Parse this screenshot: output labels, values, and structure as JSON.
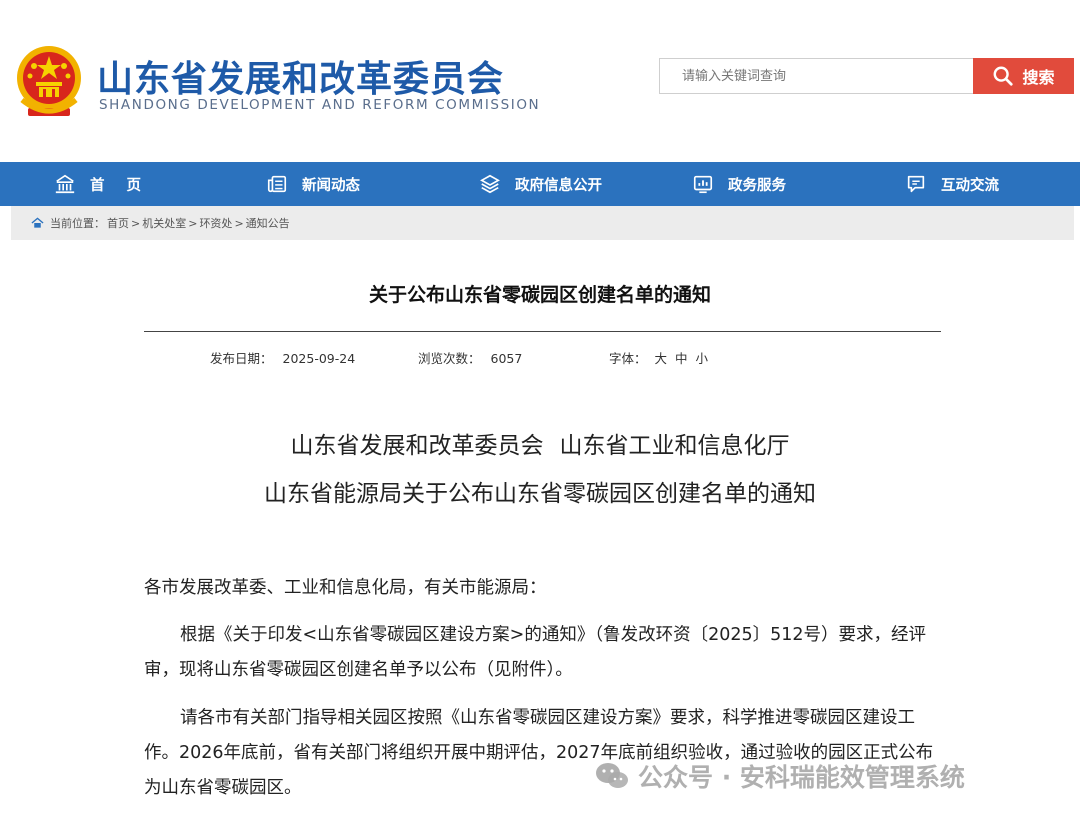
{
  "header": {
    "site_title": "山东省发展和改革委员会",
    "site_subtitle": "SHANDONG DEVELOPMENT AND REFORM COMMISSION",
    "emblem_icon": "national-emblem-icon",
    "search": {
      "placeholder": "请输入关键词查询",
      "button_label": "搜索"
    }
  },
  "nav": {
    "items": [
      {
        "label": "首页",
        "icon": "home-icon"
      },
      {
        "label": "新闻动态",
        "icon": "news-icon"
      },
      {
        "label": "政府信息公开",
        "icon": "layers-icon"
      },
      {
        "label": "政务服务",
        "icon": "chart-icon"
      },
      {
        "label": "互动交流",
        "icon": "chat-icon"
      }
    ]
  },
  "breadcrumb": {
    "prefix": "当前位置：",
    "items": [
      "首页",
      "机关处室",
      "环资处",
      "通知公告"
    ],
    "separator": ">"
  },
  "article": {
    "title": "关于公布山东省零碳园区创建名单的通知",
    "meta": {
      "date_label": "发布日期：",
      "date": "2025-09-24",
      "views_label": "浏览次数：",
      "views": "6057",
      "font_label": "字体：",
      "font_options": [
        "大",
        "中",
        "小"
      ]
    },
    "heading_line1_a": "山东省发展和改革委员会",
    "heading_line1_b": "山东省工业和信息化厅",
    "heading_line2": "山东省能源局关于公布山东省零碳园区创建名单的通知",
    "salutation": "各市发展改革委、工业和信息化局，有关市能源局：",
    "para1": "根据《关于印发<山东省零碳园区建设方案>的通知》（鲁发改环资〔2025〕512号）要求，经评审，现将山东省零碳园区创建名单予以公布（见附件）。",
    "para2": "请各市有关部门指导相关园区按照《山东省零碳园区建设方案》要求，科学推进零碳园区建设工作。2026年底前，省有关部门将组织开展中期评估，2027年底前组织验收，通过验收的园区正式公布为山东省零碳园区。"
  },
  "watermark": {
    "text": "公众号 · 安科瑞能效管理系统",
    "icon": "wechat-icon"
  },
  "colors": {
    "brand_blue": "#1e5aa8",
    "nav_blue": "#2b72be",
    "search_red": "#e14b3c",
    "breadcrumb_bg": "#ececec"
  }
}
